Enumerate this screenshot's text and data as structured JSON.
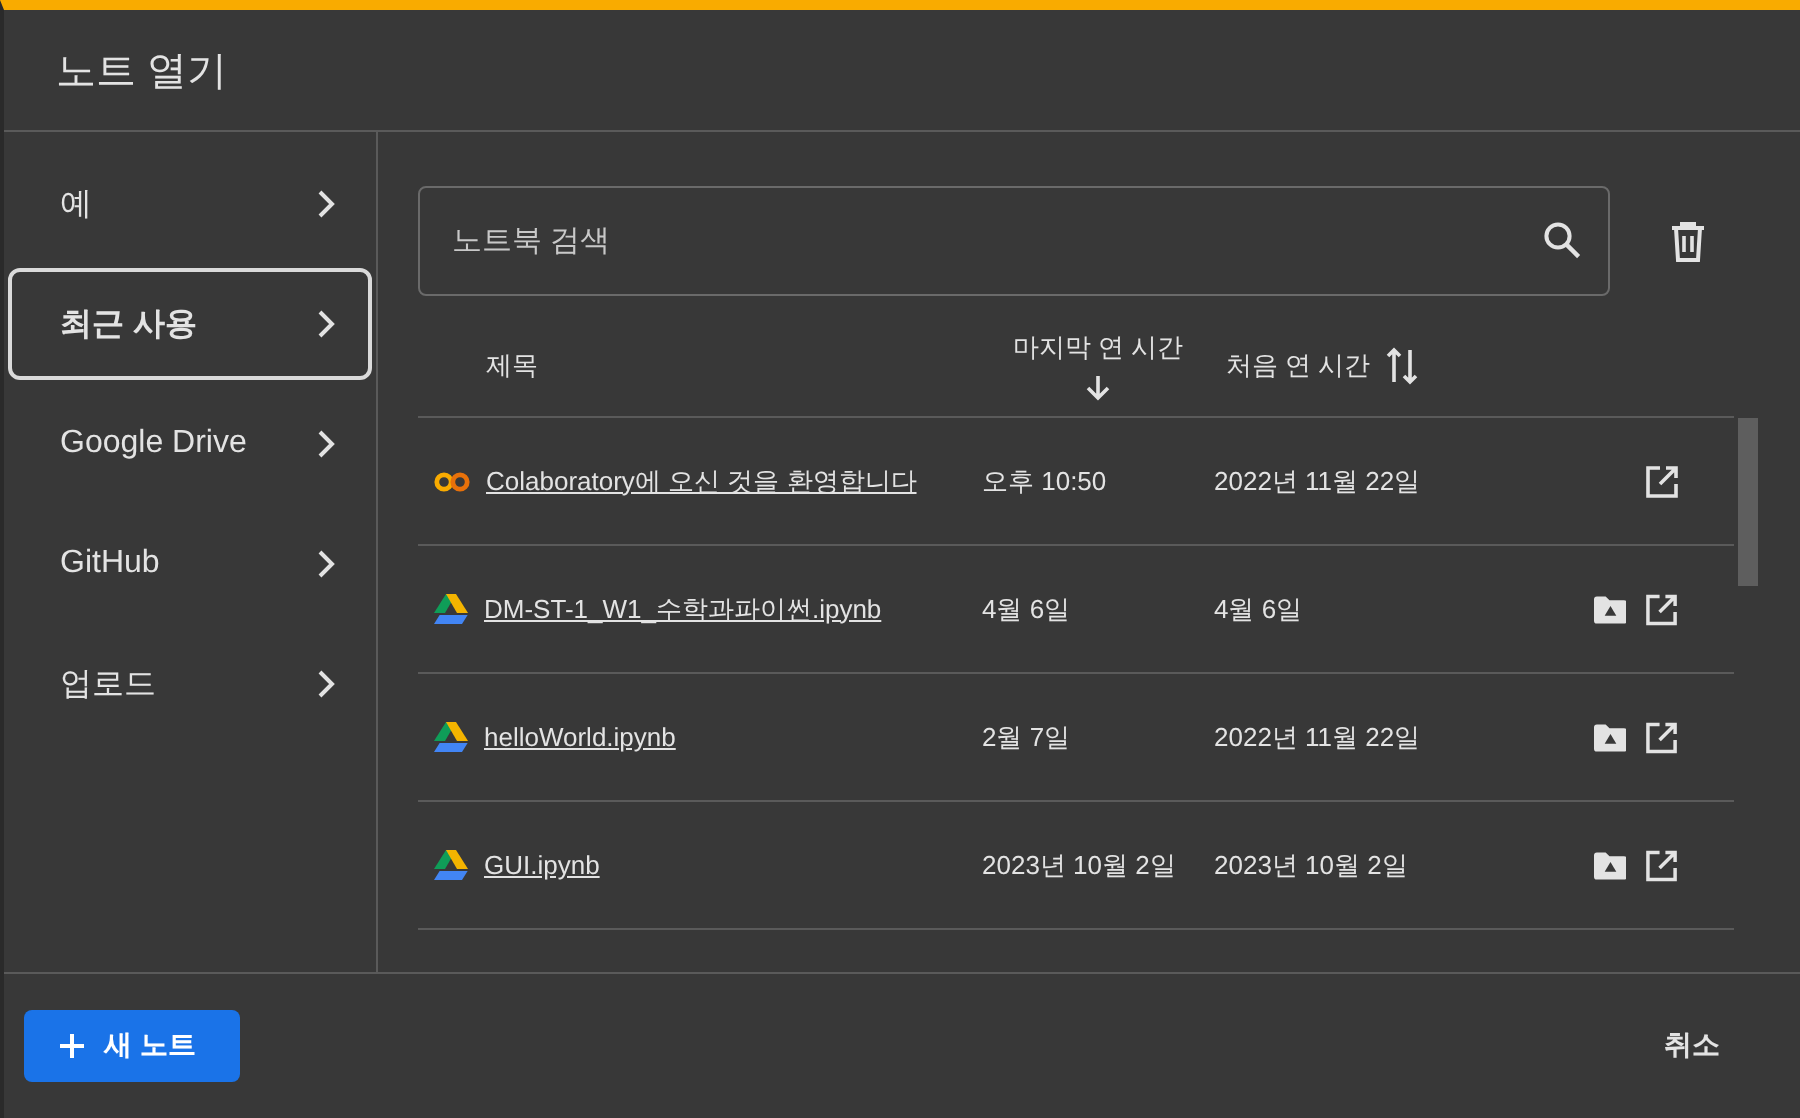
{
  "dialog": {
    "title": "노트 열기"
  },
  "sidebar": {
    "items": [
      {
        "label": "예",
        "selected": false
      },
      {
        "label": "최근 사용",
        "selected": true
      },
      {
        "label": "Google Drive",
        "selected": false
      },
      {
        "label": "GitHub",
        "selected": false
      },
      {
        "label": "업로드",
        "selected": false
      }
    ]
  },
  "search": {
    "placeholder": "노트북 검색"
  },
  "table": {
    "columns": [
      {
        "label": "제목",
        "sortable": false
      },
      {
        "label": "마지막 연 시간",
        "sortable": true,
        "sorted": true
      },
      {
        "label": "처음 연 시간",
        "sortable": true,
        "sorted": false
      }
    ],
    "rows": [
      {
        "kind": "colab",
        "title": "Colaboratory에 오신 것을 환영합니다",
        "last_opened": "오후 10:50",
        "first_opened": "2022년 11월 22일"
      },
      {
        "kind": "drive",
        "title": "DM-ST-1_W1_수학과파이썬.ipynb",
        "last_opened": "4월 6일",
        "first_opened": "4월 6일"
      },
      {
        "kind": "drive",
        "title": "helloWorld.ipynb",
        "last_opened": "2월 7일",
        "first_opened": "2022년 11월 22일"
      },
      {
        "kind": "drive",
        "title": "GUI.ipynb",
        "last_opened": "2023년 10월 2일",
        "first_opened": "2023년 10월 2일"
      }
    ]
  },
  "footer": {
    "new_button": "새 노트",
    "cancel_button": "취소"
  }
}
